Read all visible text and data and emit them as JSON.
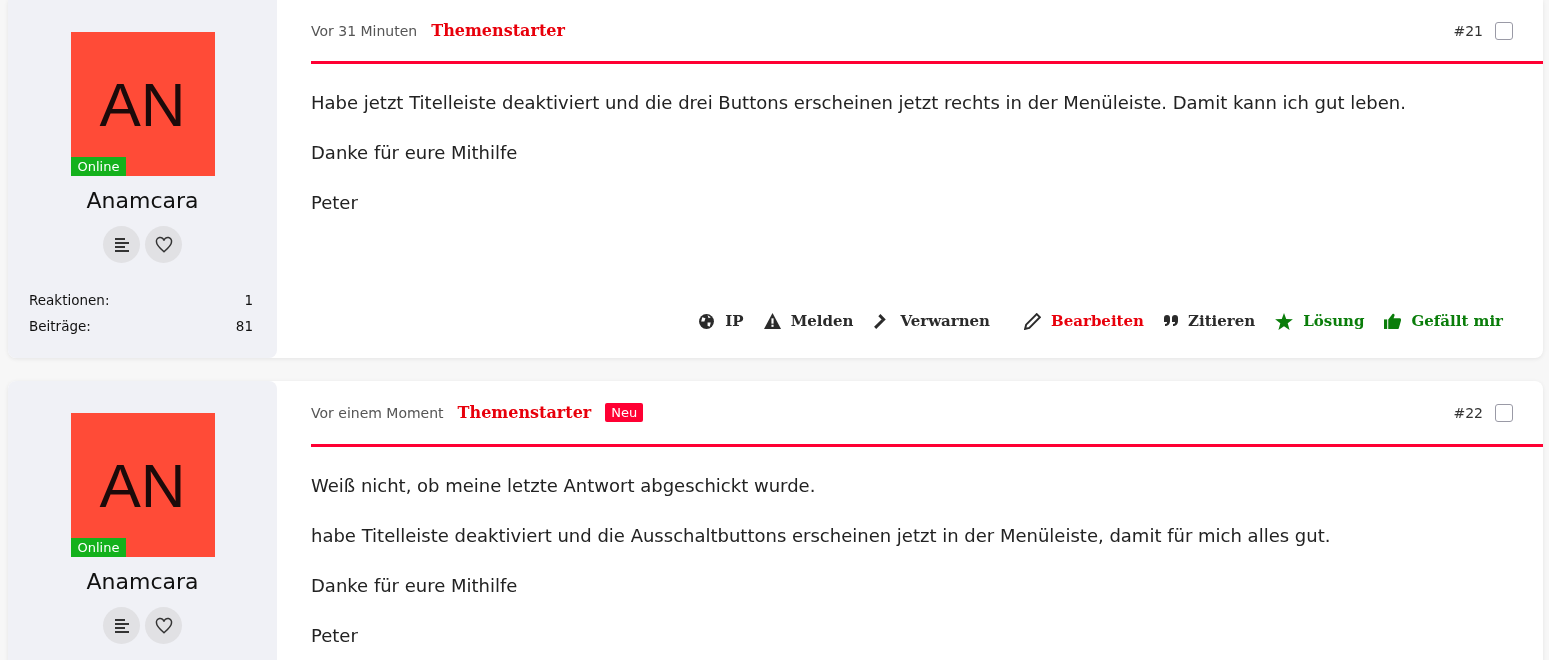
{
  "posts": [
    {
      "author": {
        "initials": "AN",
        "status": "Online",
        "name": "Anamcara",
        "stats": [
          {
            "label": "Reaktionen:",
            "value": "1"
          },
          {
            "label": "Beiträge:",
            "value": "81"
          }
        ]
      },
      "time": "Vor 31 Minuten",
      "role": "Themenstarter",
      "number": "#21",
      "selected": false,
      "paragraphs": [
        "Habe jetzt Titelleiste deaktiviert und die drei Buttons erscheinen jetzt rechts in der Menüleiste. Damit kann ich gut leben.",
        "Danke für eure Mithilfe",
        "Peter"
      ],
      "actions": [
        {
          "label": "IP",
          "kind": "neutral"
        },
        {
          "label": "Melden",
          "kind": "neutral"
        },
        {
          "label": "Verwarnen",
          "kind": "neutral"
        },
        {
          "label": "Bearbeiten",
          "kind": "edit"
        },
        {
          "label": "Zitieren",
          "kind": "neutral"
        },
        {
          "label": "Lösung",
          "kind": "positive"
        },
        {
          "label": "Gefällt mir",
          "kind": "positive"
        }
      ]
    },
    {
      "author": {
        "initials": "AN",
        "status": "Online",
        "name": "Anamcara"
      },
      "time": "Vor einem Moment",
      "role": "Themenstarter",
      "badge": "Neu",
      "number": "#22",
      "selected": false,
      "paragraphs": [
        "Weiß nicht, ob meine letzte Antwort abgeschickt wurde.",
        "habe Titelleiste deaktiviert und die Ausschaltbuttons erscheinen jetzt in der Menüleiste, damit für mich alles gut.",
        "Danke für eure Mithilfe",
        "Peter"
      ]
    }
  ]
}
